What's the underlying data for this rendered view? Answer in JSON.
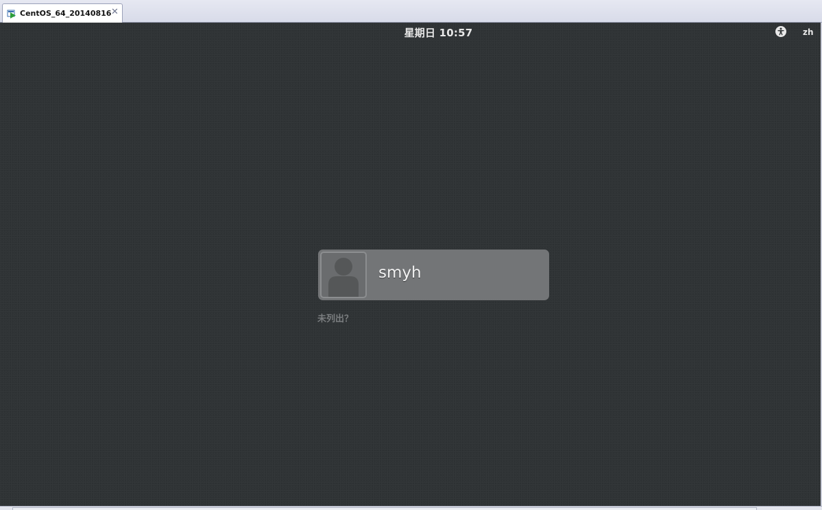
{
  "tab": {
    "title": "CentOS_64_20140816",
    "icon": "vm-running-icon",
    "close_glyph": "✕"
  },
  "topbar": {
    "clock": "星期日 10:57",
    "accessibility_icon": "accessibility-icon",
    "language": "zh"
  },
  "login": {
    "user": {
      "name": "smyh",
      "avatar_icon": "user-avatar-icon"
    },
    "not_listed": "未列出？"
  },
  "colors": {
    "background": "#2f3335",
    "user_card": "#737577",
    "tab_accent": "#2e9e3a"
  }
}
